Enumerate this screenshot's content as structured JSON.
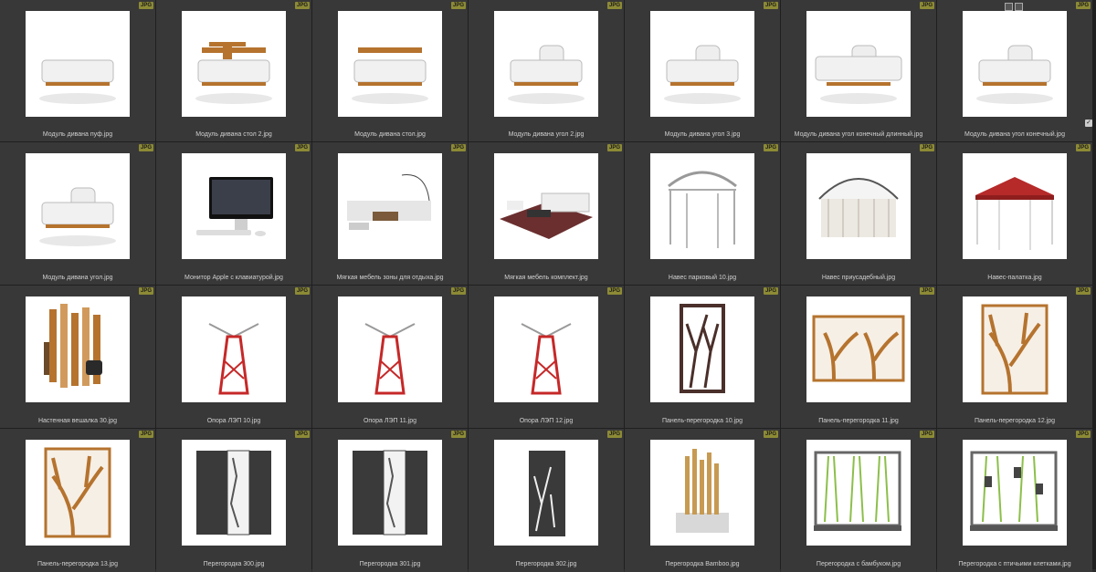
{
  "badge_label": "JPG",
  "items": [
    {
      "caption": "Модуль дивана пуф.jpg",
      "icon": "sofa-pouf"
    },
    {
      "caption": "Модуль дивана стол 2.jpg",
      "icon": "sofa-table-2"
    },
    {
      "caption": "Модуль дивана стол.jpg",
      "icon": "sofa-table"
    },
    {
      "caption": "Модуль дивана угол 2.jpg",
      "icon": "sofa-corner-2"
    },
    {
      "caption": "Модуль дивана угол 3.jpg",
      "icon": "sofa-corner-3"
    },
    {
      "caption": "Модуль дивана угол конечный длинный.jpg",
      "icon": "sofa-corner-long"
    },
    {
      "caption": "Модуль дивана угол конечный.jpg",
      "icon": "sofa-corner-end"
    },
    {
      "caption": "Модуль дивана угол.jpg",
      "icon": "sofa-corner"
    },
    {
      "caption": "Монитор Apple с клавиатурой.jpg",
      "icon": "monitor"
    },
    {
      "caption": "Мягкая мебель зоны для отдыха.jpg",
      "icon": "lounge"
    },
    {
      "caption": "Мягкая мебель комплект.jpg",
      "icon": "furniture-set"
    },
    {
      "caption": "Навес парковый 10.jpg",
      "icon": "pergola"
    },
    {
      "caption": "Навес приусадебный.jpg",
      "icon": "gazebo"
    },
    {
      "caption": "Навес-палатка.jpg",
      "icon": "tent"
    },
    {
      "caption": "Настенная вешалка 30.jpg",
      "icon": "wall-hanger"
    },
    {
      "caption": "Опора ЛЭП 10.jpg",
      "icon": "power-tower"
    },
    {
      "caption": "Опора ЛЭП 11.jpg",
      "icon": "power-tower"
    },
    {
      "caption": "Опора ЛЭП 12.jpg",
      "icon": "power-tower"
    },
    {
      "caption": "Панель-перегородка 10.jpg",
      "icon": "branch-panel"
    },
    {
      "caption": "Панель-перегородка 11.jpg",
      "icon": "tree-panel-wide"
    },
    {
      "caption": "Панель-перегородка 12.jpg",
      "icon": "tree-panel"
    },
    {
      "caption": "Панель-перегородка 13.jpg",
      "icon": "tree-panel"
    },
    {
      "caption": "Перегородка 300.jpg",
      "icon": "dark-partition"
    },
    {
      "caption": "Перегородка 301.jpg",
      "icon": "dark-partition"
    },
    {
      "caption": "Перегородка 302.jpg",
      "icon": "dark-panel"
    },
    {
      "caption": "Перегородка Bamboo.jpg",
      "icon": "bamboo"
    },
    {
      "caption": "Перегородка с бамбуком.jpg",
      "icon": "bamboo-frame"
    },
    {
      "caption": "Перегородка с птичьими клетками.jpg",
      "icon": "birdcage-frame"
    }
  ],
  "colors": {
    "wood": "#b5732e",
    "tent": "#b62a2a",
    "tower": "#c62828",
    "panel": "#3a3a3a",
    "bamboo": "#8cbf4a"
  }
}
